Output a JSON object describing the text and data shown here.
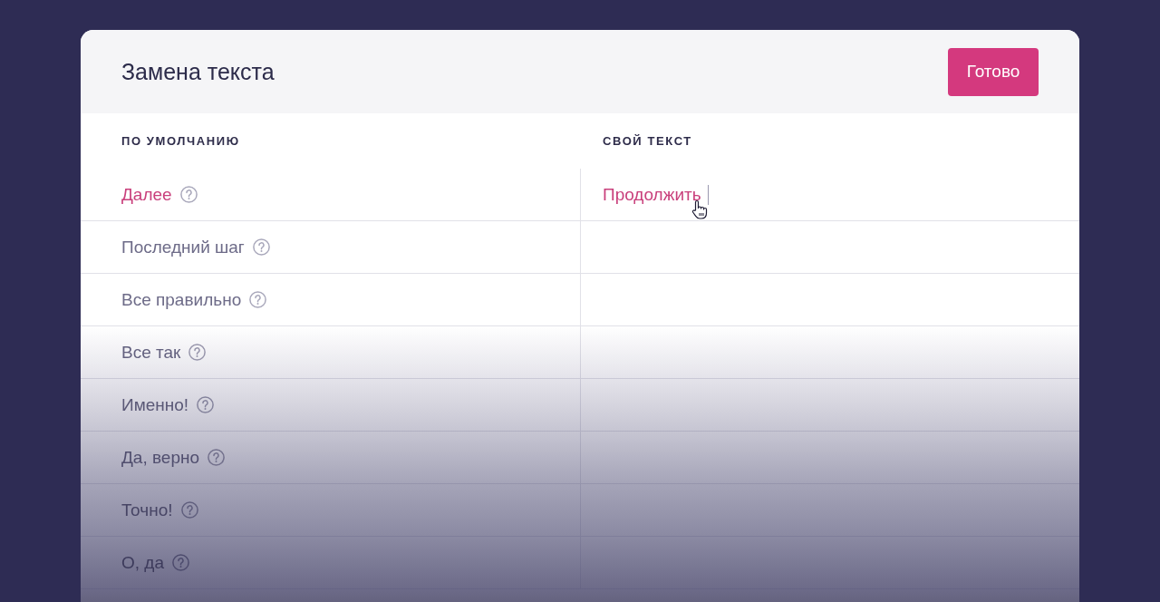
{
  "dialog": {
    "title": "Замена текста",
    "done_button": "Готово"
  },
  "table": {
    "columns": [
      "ПО УМОЛЧАНИЮ",
      "СВОЙ ТЕКСТ"
    ],
    "rows": [
      {
        "default": "Далее",
        "custom": "Продолжить",
        "selected": true
      },
      {
        "default": "Последний шаг",
        "selected": false
      },
      {
        "default": "Все правильно",
        "selected": false
      },
      {
        "default": "Все так",
        "selected": false
      },
      {
        "default": "Именно!",
        "selected": false
      },
      {
        "default": "Да, верно",
        "selected": false
      },
      {
        "default": "Точно!",
        "selected": false
      },
      {
        "default": "О, да",
        "selected": false
      }
    ]
  }
}
